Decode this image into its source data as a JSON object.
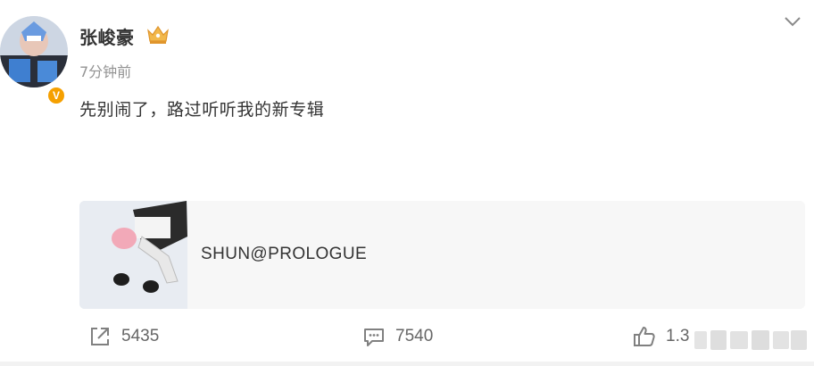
{
  "post": {
    "author": "张峻豪",
    "time": "7分钟前",
    "text": "先别闹了，路过听听我的新专辑",
    "card": {
      "title": "SHUN@PROLOGUE"
    }
  },
  "actions": {
    "share_count": "5435",
    "comment_count": "7540",
    "like_count": "1.3"
  },
  "icons": {
    "verified": "verified-v-icon",
    "badge": "crown-badge-icon",
    "more": "chevron-down-icon",
    "share": "share-icon",
    "comment": "comment-icon",
    "like": "thumbs-up-icon"
  },
  "colors": {
    "verified": "#f5a000",
    "text": "#333333",
    "muted": "#939393",
    "card_bg": "#f7f7f7"
  }
}
